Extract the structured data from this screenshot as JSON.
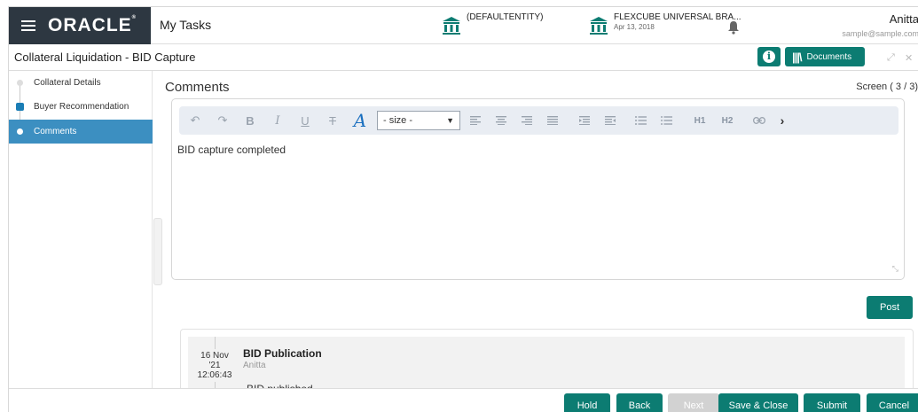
{
  "header": {
    "brand": "ORACLE",
    "app_title": "My Tasks",
    "entity": "(DEFAULTENTITY)",
    "branch_name": "FLEXCUBE UNIVERSAL BRA...",
    "branch_date": "Apr 13, 2018",
    "user_name": "Anitta",
    "user_email": "sample@sample.com"
  },
  "screen": {
    "title": "Collateral Liquidation - BID Capture",
    "documents_label": "Documents",
    "section_title": "Comments",
    "screen_count": "Screen ( 3 / 3)"
  },
  "nav": {
    "items": [
      {
        "label": "Collateral Details",
        "state": "pending"
      },
      {
        "label": "Buyer Recommendation",
        "state": "done"
      },
      {
        "label": "Comments",
        "state": "active"
      }
    ]
  },
  "editor": {
    "size_select": "- size -",
    "heading1": "H1",
    "heading2": "H2",
    "bold": "B",
    "italic": "I",
    "underline": "U",
    "strike": "T",
    "font_color": "A",
    "content": "BID capture completed"
  },
  "post_label": "Post",
  "history": [
    {
      "date_day": "16 Nov",
      "date_year": "'21",
      "time": "12:06:43",
      "title": "BID Publication",
      "user": "Anitta",
      "comment": "BID published"
    }
  ],
  "footer": {
    "hold": "Hold",
    "back": "Back",
    "next": "Next",
    "save_close": "Save & Close",
    "submit": "Submit",
    "cancel": "Cancel"
  },
  "colors": {
    "brand_bar": "#2d3741",
    "accent": "#0c7c72",
    "nav_active": "#3c8fc1",
    "icon_blue": "#1a6fbf"
  }
}
